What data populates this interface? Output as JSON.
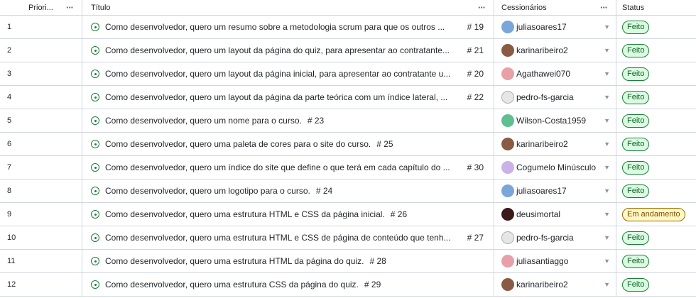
{
  "columns": {
    "priority": "Priori...",
    "title": "Título",
    "assignees": "Cessionários",
    "status": "Status"
  },
  "colors": {
    "done_green": "#1a7f37",
    "progress_yellow": "#fff8c5"
  },
  "rows": [
    {
      "num": "1",
      "title": "Como desenvolvedor, quero um resumo sobre a metodologia scrum para que os outros ...",
      "issue": "# 19",
      "assignee": "juliasoares17",
      "avatar": "#7ba6d9",
      "status": "Feito"
    },
    {
      "num": "2",
      "title": "Como desenvolvedor, quero um layout da página do quiz, para apresentar ao contratante...",
      "issue": "# 21",
      "assignee": "karinaribeiro2",
      "avatar": "#8a5a44",
      "status": "Feito"
    },
    {
      "num": "3",
      "title": "Como desenvolvedor, quero um layout da página inicial, para apresentar ao contratante u...",
      "issue": "# 20",
      "assignee": "Agathawei070",
      "avatar": "#e8a0a8",
      "status": "Feito"
    },
    {
      "num": "4",
      "title": "Como desenvolvedor, quero um layout da página da parte teórica com um índice lateral, ...",
      "issue": "# 22",
      "assignee": "pedro-fs-garcia",
      "avatar": "#e6e6e6",
      "status": "Feito"
    },
    {
      "num": "5",
      "title": "Como desenvolvedor, quero um nome para o curso.",
      "issue": "# 23",
      "assignee": "Wilson-Costa1959",
      "avatar": "#5fbf8f",
      "status": "Feito"
    },
    {
      "num": "6",
      "title": "Como desenvolvedor, quero uma paleta de cores para o site do curso.",
      "issue": "# 25",
      "assignee": "karinaribeiro2",
      "avatar": "#8a5a44",
      "status": "Feito"
    },
    {
      "num": "7",
      "title": "Como desenvolvedor, quero um índice do site que define o que terá em cada capítulo do ...",
      "issue": "# 30",
      "assignee": "Cogumelo Minúsculo",
      "avatar": "#c9b3e6",
      "status": "Feito"
    },
    {
      "num": "8",
      "title": "Como desenvolvedor, quero um logotipo para o curso.",
      "issue": "# 24",
      "assignee": "juliasoares17",
      "avatar": "#7ba6d9",
      "status": "Feito"
    },
    {
      "num": "9",
      "title": "Como desenvolvedor, quero uma estrutura HTML e CSS da página inicial.",
      "issue": "# 26",
      "assignee": "deusimortal",
      "avatar": "#3b1a1a",
      "status": "Em andamento"
    },
    {
      "num": "10",
      "title": "Como desenvolvedor, quero uma estrutura HTML e CSS de página de conteúdo que tenh...",
      "issue": "# 27",
      "assignee": "pedro-fs-garcia",
      "avatar": "#e6e6e6",
      "status": "Feito"
    },
    {
      "num": "11",
      "title": "Como desenvolvedor, quero uma estrutura HTML da página do quiz.",
      "issue": "# 28",
      "assignee": "juliasantiaggo",
      "avatar": "#e8a0a8",
      "status": "Feito"
    },
    {
      "num": "12",
      "title": "Como desenvolvedor, quero uma estrutura CSS da página do quiz.",
      "issue": "# 29",
      "assignee": "karinaribeiro2",
      "avatar": "#8a5a44",
      "status": "Feito"
    }
  ]
}
